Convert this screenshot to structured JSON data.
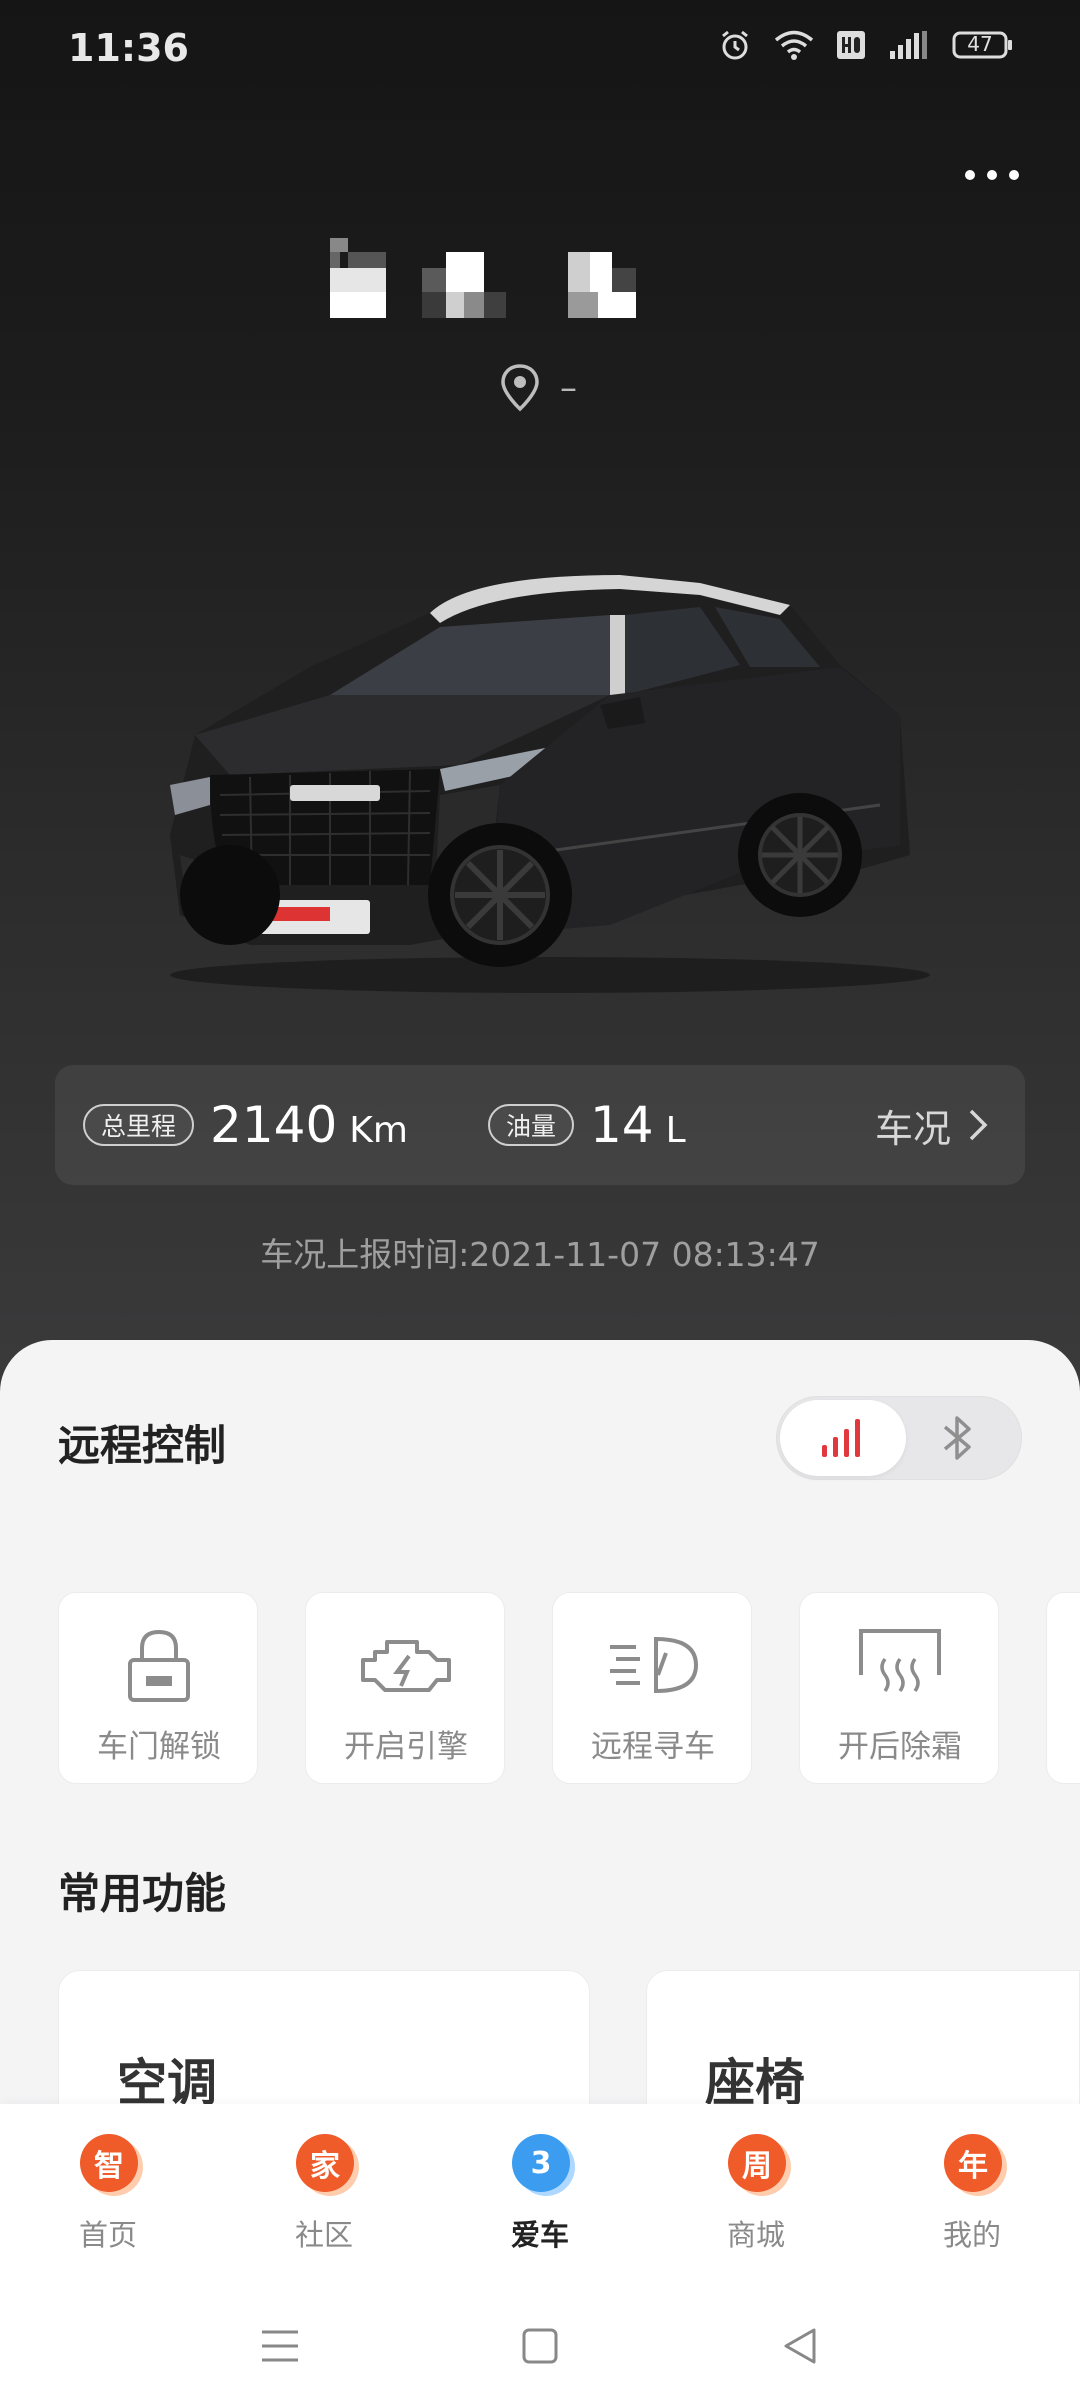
{
  "status_bar": {
    "time": "11:36",
    "battery": "47"
  },
  "vehicle": {
    "location_text": "–"
  },
  "stats": {
    "mileage_label": "总里程",
    "mileage_value": "2140",
    "mileage_unit": "Km",
    "fuel_label": "油量",
    "fuel_value": "14",
    "fuel_unit": "L",
    "status_link": "车况"
  },
  "report_time": "车况上报时间:2021-11-07 08:13:47",
  "remote_control": {
    "title": "远程控制",
    "mode_selected": "cellular",
    "items": [
      {
        "label": "车门解锁",
        "icon": "lock-icon"
      },
      {
        "label": "开启引擎",
        "icon": "engine-icon"
      },
      {
        "label": "远程寻车",
        "icon": "headlight-icon"
      },
      {
        "label": "开后除霜",
        "icon": "rear-defrost-icon"
      }
    ]
  },
  "common_functions": {
    "title": "常用功能",
    "items": [
      {
        "label": "空调"
      },
      {
        "label": "座椅"
      }
    ]
  },
  "bottom_nav": {
    "active": "爱车",
    "items": [
      {
        "label": "首页",
        "badge": "智",
        "color": "#f05b2a"
      },
      {
        "label": "社区",
        "badge": "家",
        "color": "#f05b2a"
      },
      {
        "label": "爱车",
        "badge": "3",
        "color": "#3b9cf0"
      },
      {
        "label": "商城",
        "badge": "周",
        "color": "#f05b2a"
      },
      {
        "label": "我的",
        "badge": "年",
        "color": "#f05b2a"
      }
    ]
  },
  "colors": {
    "accent_red": "#e0383e",
    "badge_orange": "#f05b2a",
    "badge_blue": "#3b9cf0"
  }
}
